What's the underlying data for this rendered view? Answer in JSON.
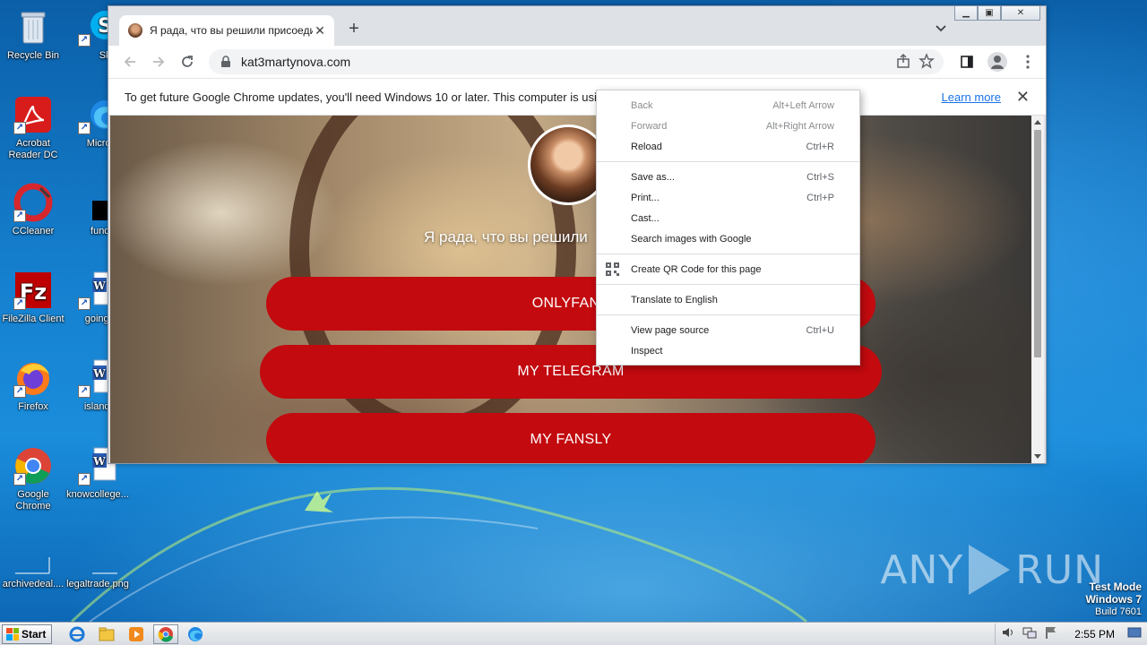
{
  "desktop": {
    "icons": [
      {
        "label": "Recycle Bin"
      },
      {
        "label": "Skype"
      },
      {
        "label": "Acrobat Reader DC"
      },
      {
        "label": "Microsoft"
      },
      {
        "label": "CCleaner"
      },
      {
        "label": "fundi.."
      },
      {
        "label": "FileZilla Client"
      },
      {
        "label": "goingsh"
      },
      {
        "label": "Firefox"
      },
      {
        "label": "islandsg"
      },
      {
        "label": "Google Chrome"
      },
      {
        "label": "knowcollege..."
      },
      {
        "label": "archivedeal...."
      },
      {
        "label": "legaltrade.png"
      }
    ],
    "watermark": {
      "left": "ANY",
      "right": "RUN"
    },
    "test_mode": {
      "line1": "Test Mode",
      "line2": "Windows 7",
      "line3": "Build 7601"
    }
  },
  "taskbar": {
    "start_label": "Start",
    "clock": "2:55 PM"
  },
  "browser": {
    "tab_title": "Я рада, что вы решили присоедин",
    "url": "kat3martynova.com",
    "infobar": {
      "message": "To get future Google Chrome updates, you'll need Windows 10 or later. This computer is using",
      "learn_more": "Learn more"
    }
  },
  "page": {
    "headline": "Я рада, что вы решили",
    "buttons": [
      {
        "label": "ONLYFANS"
      },
      {
        "label": "MY TELEGRAM"
      },
      {
        "label": "MY FANSLY"
      }
    ]
  },
  "context_menu": {
    "items": [
      {
        "label": "Back",
        "shortcut": "Alt+Left Arrow",
        "disabled": true
      },
      {
        "label": "Forward",
        "shortcut": "Alt+Right Arrow",
        "disabled": true
      },
      {
        "label": "Reload",
        "shortcut": "Ctrl+R"
      },
      {
        "label": "Save as...",
        "shortcut": "Ctrl+S"
      },
      {
        "label": "Print...",
        "shortcut": "Ctrl+P"
      },
      {
        "label": "Cast..."
      },
      {
        "label": "Search images with Google"
      },
      {
        "label": "Create QR Code for this page"
      },
      {
        "label": "Translate to English"
      },
      {
        "label": "View page source",
        "shortcut": "Ctrl+U"
      },
      {
        "label": "Inspect"
      }
    ]
  },
  "colors": {
    "accent_red": "#c20a0f",
    "link_blue": "#1a73e8"
  }
}
